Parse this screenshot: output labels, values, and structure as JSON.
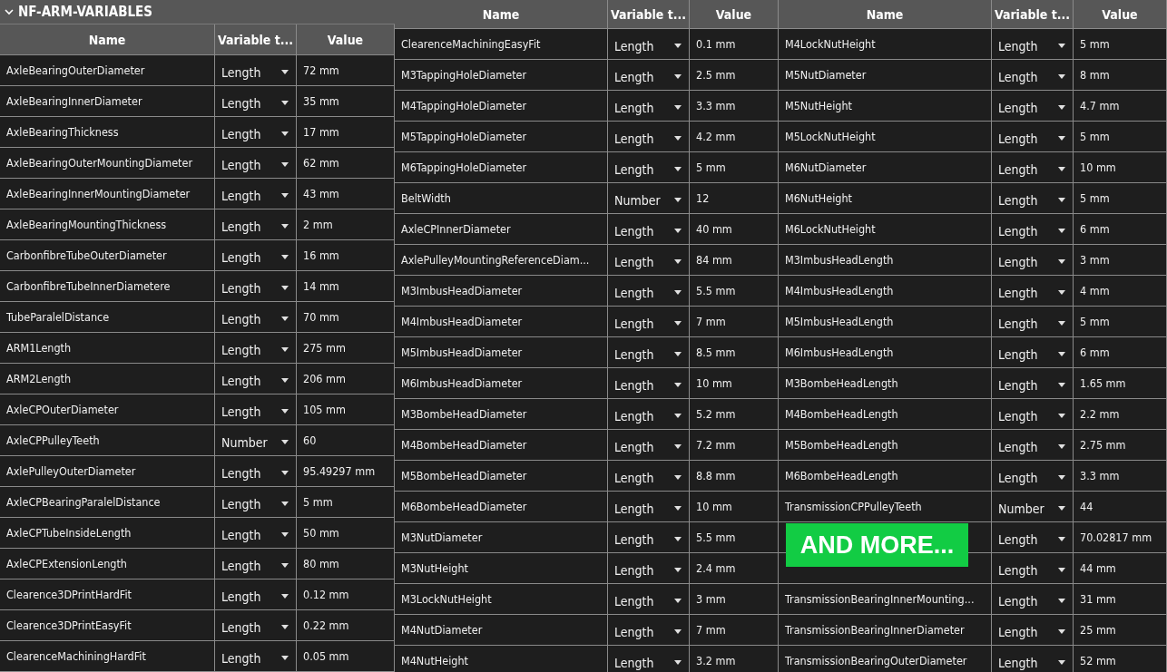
{
  "group": {
    "title": "NF-ARM-VARIABLES",
    "expanded": true
  },
  "tables": [
    {
      "columns": [
        "Name",
        "Variable t...",
        "Value"
      ],
      "rows": [
        {
          "name": "AxleBearingOuterDiameter",
          "type": "Length",
          "value": "72 mm"
        },
        {
          "name": "AxleBearingInnerDiameter",
          "type": "Length",
          "value": "35 mm"
        },
        {
          "name": "AxleBearingThickness",
          "type": "Length",
          "value": "17 mm"
        },
        {
          "name": "AxleBearingOuterMountingDiameter",
          "type": "Length",
          "value": "62 mm"
        },
        {
          "name": "AxleBearingInnerMountingDiameter",
          "type": "Length",
          "value": "43 mm"
        },
        {
          "name": "AxleBearingMountingThickness",
          "type": "Length",
          "value": "2 mm"
        },
        {
          "name": "CarbonfibreTubeOuterDiameter",
          "type": "Length",
          "value": "16 mm"
        },
        {
          "name": "CarbonfibreTubeInnerDiametere",
          "type": "Length",
          "value": "14 mm"
        },
        {
          "name": "TubeParalelDistance",
          "type": "Length",
          "value": "70 mm"
        },
        {
          "name": "ARM1Length",
          "type": "Length",
          "value": "275 mm"
        },
        {
          "name": "ARM2Length",
          "type": "Length",
          "value": "206 mm"
        },
        {
          "name": "AxleCPOuterDiameter",
          "type": "Length",
          "value": "105 mm"
        },
        {
          "name": "AxleCPPulleyTeeth",
          "type": "Number",
          "value": "60"
        },
        {
          "name": "AxlePulleyOuterDiameter",
          "type": "Length",
          "value": "95.49297 mm"
        },
        {
          "name": "AxleCPBearingParalelDistance",
          "type": "Length",
          "value": "5 mm"
        },
        {
          "name": "AxleCPTubeInsideLength",
          "type": "Length",
          "value": "50 mm"
        },
        {
          "name": "AxleCPExtensionLength",
          "type": "Length",
          "value": "80 mm"
        },
        {
          "name": "Clearence3DPrintHardFit",
          "type": "Length",
          "value": "0.12 mm"
        },
        {
          "name": "Clearence3DPrintEasyFit",
          "type": "Length",
          "value": "0.22 mm"
        },
        {
          "name": "ClearenceMachiningHardFit",
          "type": "Length",
          "value": "0.05 mm"
        }
      ]
    },
    {
      "columns": [
        "Name",
        "Variable t...",
        "Value"
      ],
      "rows": [
        {
          "name": "ClearenceMachiningEasyFit",
          "type": "Length",
          "value": "0.1 mm"
        },
        {
          "name": "M3TappingHoleDiameter",
          "type": "Length",
          "value": "2.5 mm"
        },
        {
          "name": "M4TappingHoleDiameter",
          "type": "Length",
          "value": "3.3 mm"
        },
        {
          "name": "M5TappingHoleDiameter",
          "type": "Length",
          "value": "4.2 mm"
        },
        {
          "name": "M6TappingHoleDiameter",
          "type": "Length",
          "value": "5 mm"
        },
        {
          "name": "BeltWidth",
          "type": "Number",
          "value": "12"
        },
        {
          "name": "AxleCPInnerDiameter",
          "type": "Length",
          "value": "40 mm"
        },
        {
          "name": "AxlePulleyMountingReferenceDiam...",
          "type": "Length",
          "value": "84 mm"
        },
        {
          "name": "M3ImbusHeadDiameter",
          "type": "Length",
          "value": "5.5 mm"
        },
        {
          "name": "M4ImbusHeadDiameter",
          "type": "Length",
          "value": "7 mm"
        },
        {
          "name": "M5ImbusHeadDiameter",
          "type": "Length",
          "value": "8.5 mm"
        },
        {
          "name": "M6ImbusHeadDiameter",
          "type": "Length",
          "value": "10 mm"
        },
        {
          "name": "M3BombeHeadDiameter",
          "type": "Length",
          "value": "5.2 mm"
        },
        {
          "name": "M4BombeHeadDiameter",
          "type": "Length",
          "value": "7.2 mm"
        },
        {
          "name": "M5BombeHeadDiameter",
          "type": "Length",
          "value": "8.8 mm"
        },
        {
          "name": "M6BombeHeadDiameter",
          "type": "Length",
          "value": "10 mm"
        },
        {
          "name": "M3NutDiameter",
          "type": "Length",
          "value": "5.5 mm"
        },
        {
          "name": "M3NutHeight",
          "type": "Length",
          "value": "2.4 mm"
        },
        {
          "name": "M3LockNutHeight",
          "type": "Length",
          "value": "3 mm"
        },
        {
          "name": "M4NutDiameter",
          "type": "Length",
          "value": "7 mm"
        },
        {
          "name": "M4NutHeight",
          "type": "Length",
          "value": "3.2 mm"
        }
      ]
    },
    {
      "columns": [
        "Name",
        "Variable t...",
        "Value"
      ],
      "rows": [
        {
          "name": "M4LockNutHeight",
          "type": "Length",
          "value": "5 mm"
        },
        {
          "name": "M5NutDiameter",
          "type": "Length",
          "value": "8 mm"
        },
        {
          "name": "M5NutHeight",
          "type": "Length",
          "value": "4.7 mm"
        },
        {
          "name": "M5LockNutHeight",
          "type": "Length",
          "value": "5 mm"
        },
        {
          "name": "M6NutDiameter",
          "type": "Length",
          "value": "10 mm"
        },
        {
          "name": "M6NutHeight",
          "type": "Length",
          "value": "5 mm"
        },
        {
          "name": "M6LockNutHeight",
          "type": "Length",
          "value": "6 mm"
        },
        {
          "name": "M3ImbusHeadLength",
          "type": "Length",
          "value": "3 mm"
        },
        {
          "name": "M4ImbusHeadLength",
          "type": "Length",
          "value": "4 mm"
        },
        {
          "name": "M5ImbusHeadLength",
          "type": "Length",
          "value": "5 mm"
        },
        {
          "name": "M6ImbusHeadLength",
          "type": "Length",
          "value": "6 mm"
        },
        {
          "name": "M3BombeHeadLength",
          "type": "Length",
          "value": "1.65 mm"
        },
        {
          "name": "M4BombeHeadLength",
          "type": "Length",
          "value": "2.2 mm"
        },
        {
          "name": "M5BombeHeadLength",
          "type": "Length",
          "value": "2.75 mm"
        },
        {
          "name": "M6BombeHeadLength",
          "type": "Length",
          "value": "3.3 mm"
        },
        {
          "name": "TransmissionCPPulleyTeeth",
          "type": "Number",
          "value": "44"
        },
        {
          "type": "Length",
          "value": "70.02817 mm"
        },
        {
          "type": "Length",
          "value": "44 mm"
        },
        {
          "name": "TransmissionBearingInnerMounting...",
          "type": "Length",
          "value": "31 mm"
        },
        {
          "name": "TransmissionBearingInnerDiameter",
          "type": "Length",
          "value": "25 mm"
        },
        {
          "name": "TransmissionBearingOuterDiameter",
          "type": "Length",
          "value": "52 mm"
        }
      ]
    }
  ],
  "banner": {
    "text": "AND MORE..."
  }
}
